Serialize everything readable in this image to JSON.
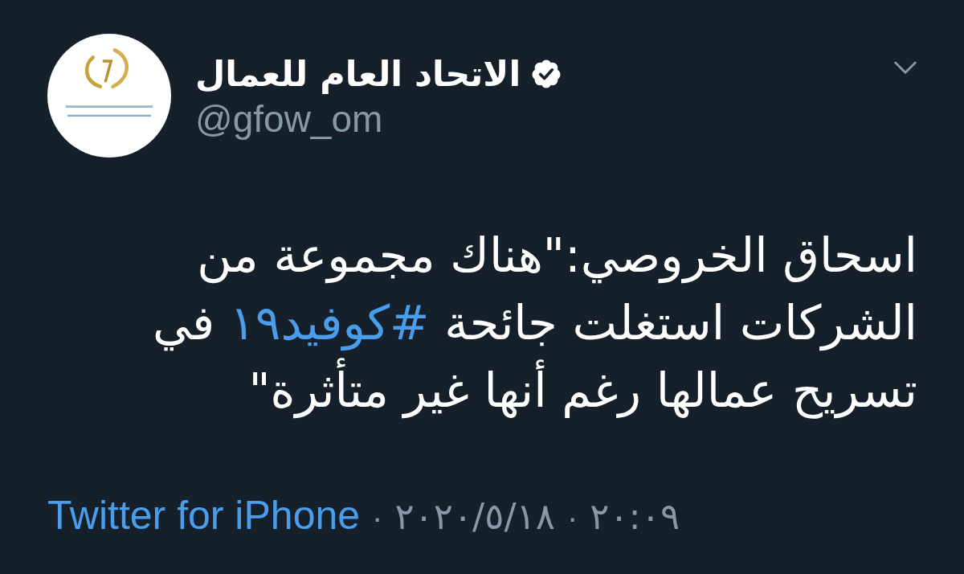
{
  "tweet": {
    "author": {
      "name": "الاتحاد العام للعمال",
      "verified": true,
      "handle": "@gfow_om"
    },
    "text": [
      {
        "kind": "text",
        "text": "اسحاق الخروصي:\"هناك مجموعة من الشركات استغلت جائحة "
      },
      {
        "kind": "hashtag",
        "text": "#كوفيد١٩"
      },
      {
        "kind": "text",
        "text": " في تسريح عمالها رغم أنها غير متأثرة\""
      }
    ],
    "footer": [
      {
        "kind": "time",
        "text": "٢٠:٠٩"
      },
      {
        "kind": "separator",
        "text": "·"
      },
      {
        "kind": "date",
        "text": "٢٠٢٠/٥/١٨"
      },
      {
        "kind": "separator",
        "text": "·"
      },
      {
        "kind": "source",
        "text": "Twitter for iPhone"
      }
    ]
  }
}
